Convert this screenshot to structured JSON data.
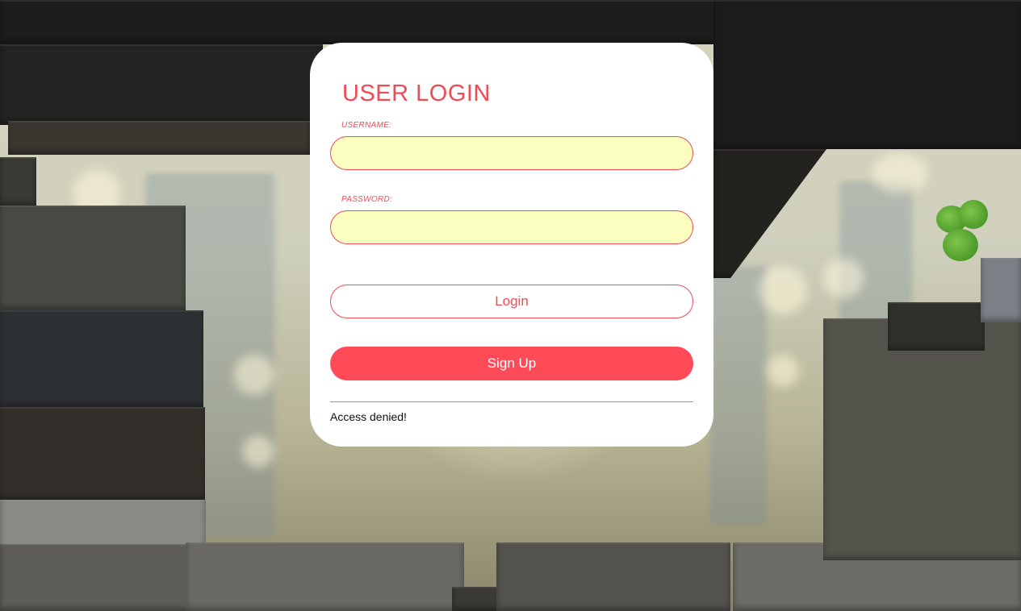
{
  "login_form": {
    "title": "USER LOGIN",
    "username_label": "USERNAME:",
    "username_value": "",
    "password_label": "PASSWORD:",
    "password_value": "",
    "login_label": "Login",
    "signup_label": "Sign Up",
    "status_message": "Access denied!"
  },
  "colors": {
    "accent": "#f04a55",
    "signup_button": "#ff4a57",
    "input_background": "#fbffc0",
    "card_background": "#ffffff"
  }
}
